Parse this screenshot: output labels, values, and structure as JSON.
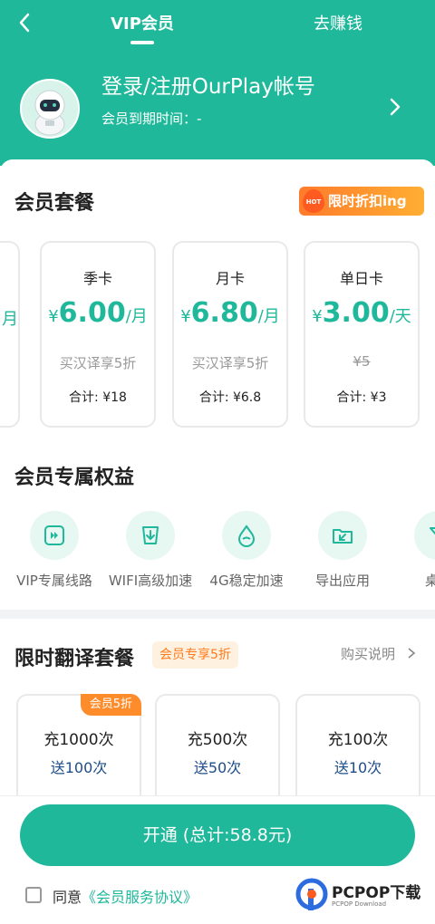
{
  "header": {
    "back_icon": "chevron-left-icon",
    "tab_vip": "VIP会员",
    "tab_earn": "去赚钱",
    "login_title": "登录/注册OurPlay帐号",
    "expire_text": "会员到期时间：-",
    "accent": "#1fb89a"
  },
  "packages": {
    "title": "会员套餐",
    "promo_badge": "HOT 限时折扣ing",
    "partial_left_price_digit": "月",
    "plans": [
      {
        "name": "季卡",
        "currency": "¥",
        "price": "6.00",
        "unit": "/月",
        "sub": "买汉译享5折",
        "total": "合计: ¥18"
      },
      {
        "name": "月卡",
        "currency": "¥",
        "price": "6.80",
        "unit": "/月",
        "sub": "买汉译享5折",
        "total": "合计: ¥6.8"
      },
      {
        "name": "单日卡",
        "currency": "¥",
        "price": "3.00",
        "unit": "/天",
        "sub": "¥5",
        "total": "合计: ¥3"
      }
    ]
  },
  "benefits": {
    "title": "会员专属权益",
    "items": [
      {
        "label": "VIP专属线路",
        "icon": "fast-forward-icon"
      },
      {
        "label": "WIFI高级加速",
        "icon": "download-icon"
      },
      {
        "label": "4G稳定加速",
        "icon": "drop-icon"
      },
      {
        "label": "导出应用",
        "icon": "folder-export-icon"
      },
      {
        "label": "桌面",
        "icon": "funnel-icon"
      }
    ]
  },
  "translation": {
    "title": "限时翻译套餐",
    "member_badge": "会员专享5折",
    "buy_note": "购买说明",
    "cards": [
      {
        "title": "充1000次",
        "bonus": "送100次",
        "corner": "会员5折"
      },
      {
        "title": "充500次",
        "bonus": "送50次"
      },
      {
        "title": "充100次",
        "bonus": "送10次"
      }
    ]
  },
  "footer": {
    "open_button": "开通 (总计:58.8元)",
    "agree_prefix": "同意",
    "agree_link": "《会员服务协议》",
    "watermark": "PCPOP下载",
    "watermark_sub": "PCPOP Download"
  }
}
